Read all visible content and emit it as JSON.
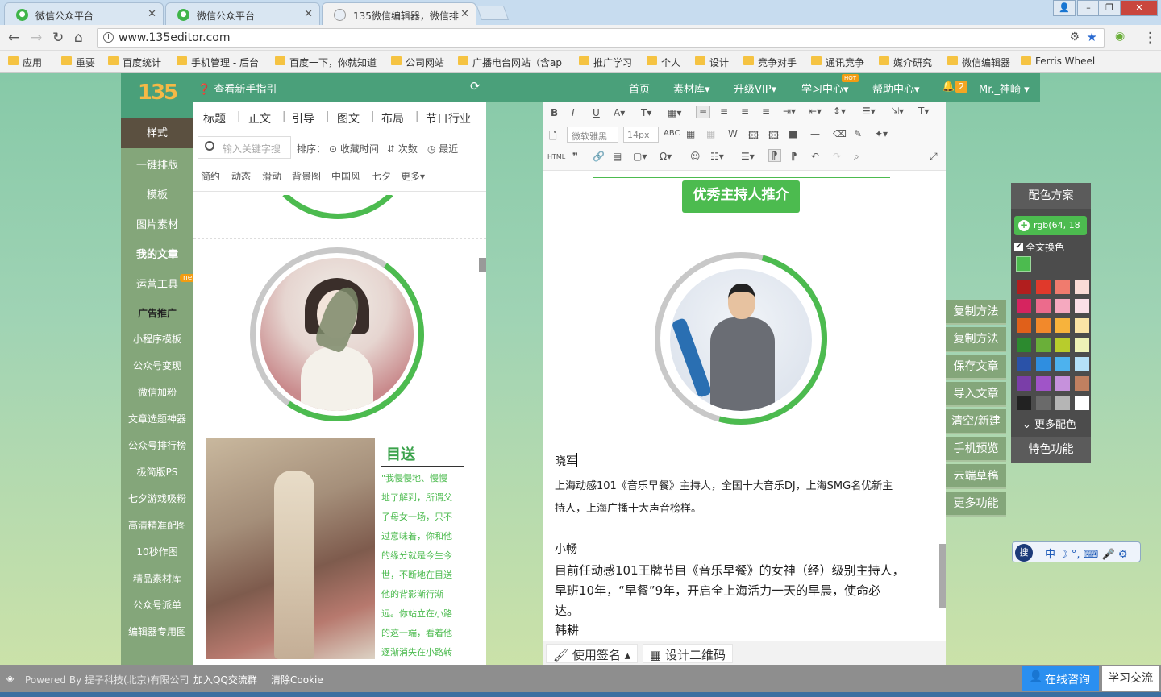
{
  "browser": {
    "tabs": [
      {
        "title": "微信公众平台",
        "active": false
      },
      {
        "title": "微信公众平台",
        "active": false
      },
      {
        "title": "135微信编辑器，微信排",
        "active": true
      }
    ],
    "url": "www.135editor.com",
    "bookmarks": [
      "应用",
      "重要",
      "百度统计",
      "手机管理 - 后台",
      "百度一下，你就知道",
      "公司网站",
      "广播电台网站（含ap",
      "推广学习",
      "个人",
      "设计",
      "竞争对手",
      "通讯竞争",
      "媒介研究",
      "微信编辑器",
      "Ferris Wheel"
    ]
  },
  "header": {
    "logo": "135",
    "guide": "查看新手指引",
    "nav": [
      "首页",
      "素材库▾",
      "升级VIP▾",
      "学习中心▾",
      "帮助中心▾"
    ],
    "hot_badge": "HOT",
    "notify_count": "2",
    "user": "Mr._神崎 ▾"
  },
  "sidebar": {
    "items": [
      "样式",
      "一键排版",
      "模板",
      "图片素材",
      "我的文章",
      "运营工具",
      "广告推广",
      "小程序模板",
      "公众号变现",
      "微信加粉",
      "文章选题神器",
      "公众号排行榜",
      "极简版PS",
      "七夕游戏吸粉",
      "高清精准配图",
      "10秒作图",
      "精品素材库",
      "公众号派单",
      "编辑器专用图"
    ],
    "new_badge": "new"
  },
  "stylepanel": {
    "categories": [
      "标题",
      "正文",
      "引导",
      "图文",
      "布局",
      "节日行业"
    ],
    "search_placeholder": "输入关键字搜",
    "sort_label": "排序：",
    "sort_options": [
      "⊙ 收藏时间",
      "⇵ 次数",
      "◷ 最近"
    ],
    "tags": [
      "简约",
      "动态",
      "滑动",
      "背景图",
      "中国风",
      "七夕",
      "更多▾"
    ],
    "card_title": "目送",
    "poem_lines": [
      "\"我慢慢地、慢慢",
      "地了解到，所谓父",
      "子母女一场，只不",
      "过意味着，你和他",
      "的缘分就是今生今",
      "世，不断地在目送",
      "他的背影渐行渐",
      "远。你站立在小路",
      "的这一端，看着他",
      "逐渐消失在小路转"
    ]
  },
  "editor": {
    "font": "微软雅黑",
    "fontsize": "14px",
    "heading": "优秀主持人推介",
    "name1": "晓军",
    "desc1_line1": "上海动感101《音乐早餐》主持人，全国十大音乐DJ，上海SMG名优新主",
    "desc1_line2": "持人，上海广播十大声音榜样。",
    "name2": "小畅",
    "desc2_line1": "目前任动感101王牌节目《音乐早餐》的女神（经）级别主持人，",
    "desc2_line2": "早班10年，“早餐”9年，开启全上海活力一天的早晨，使命必",
    "desc2_line3": "达。",
    "name3": "韩耕",
    "footer_buttons": [
      "使用签名 ▴",
      "设计二维码"
    ]
  },
  "righttools": [
    "复制方法",
    "复制方法",
    "保存文章",
    "导入文章",
    "清空/新建",
    "手机预览",
    "云端草稿",
    "更多功能"
  ],
  "palette": {
    "title": "配色方案",
    "rgb": "rgb(64, 18",
    "all_change": "全文换色",
    "current_color": "#4cbb4f",
    "swatches": [
      [
        "#b11e1e",
        "#e0392b",
        "#f07b6e",
        "#fadcd6"
      ],
      [
        "#d6245f",
        "#ec6b8c",
        "#f5a9bf",
        "#fbe0e8"
      ],
      [
        "#e0601a",
        "#f2892b",
        "#f7b33c",
        "#fbe4a6"
      ],
      [
        "#2c8a2f",
        "#6aaf39",
        "#b8cc2c",
        "#eef2b7"
      ],
      [
        "#2a52a8",
        "#2f8ee0",
        "#4db2ee",
        "#b5e0f7"
      ],
      [
        "#7a3ea8",
        "#a054c8",
        "#c691dc",
        "#c08060"
      ],
      [
        "#222222",
        "#6a6a6a",
        "#b5b5b5",
        "#ffffff"
      ]
    ],
    "more": "更多配色",
    "special": "特色功能"
  },
  "ime": {
    "label": "中 ☽ °, ⌨ 🎤 ⚙"
  },
  "footer": {
    "powered": "Powered By 提子科技(北京)有限公司",
    "qq": "加入QQ交流群",
    "cookie": "清除Cookie",
    "consult": "在线咨询",
    "study": "学习交流"
  }
}
